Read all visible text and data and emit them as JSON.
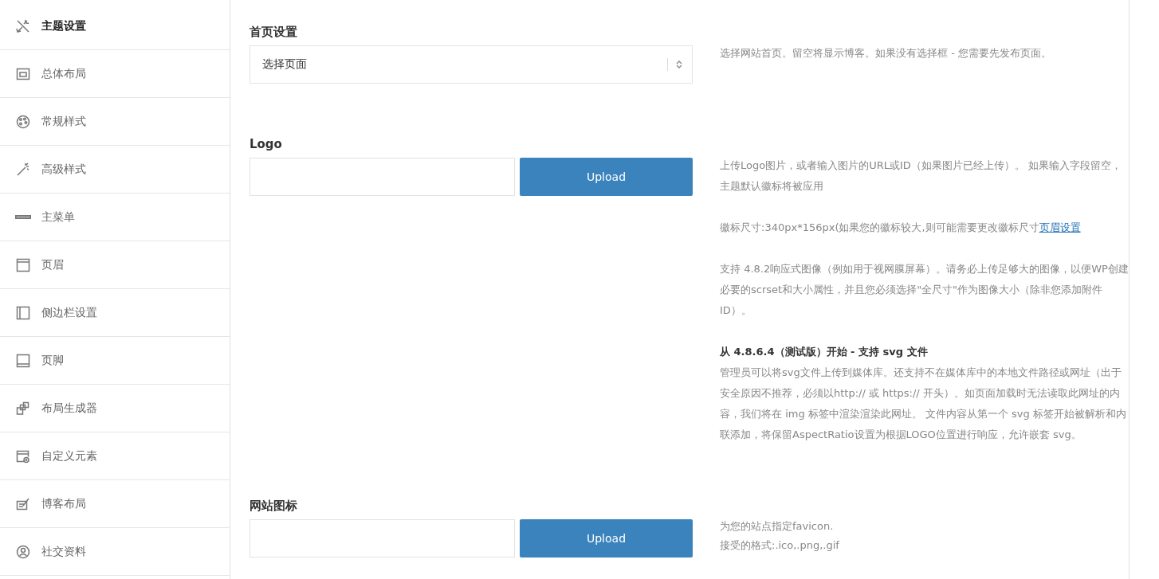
{
  "sidebar": {
    "items": [
      {
        "label": "主题设置",
        "selected": true
      },
      {
        "label": "总体布局",
        "selected": false
      },
      {
        "label": "常规样式",
        "selected": false
      },
      {
        "label": "高级样式",
        "selected": false
      },
      {
        "label": "主菜单",
        "selected": false
      },
      {
        "label": "页眉",
        "selected": false
      },
      {
        "label": "侧边栏设置",
        "selected": false
      },
      {
        "label": "页脚",
        "selected": false
      },
      {
        "label": "布局生成器",
        "selected": false
      },
      {
        "label": "自定义元素",
        "selected": false
      },
      {
        "label": "博客布局",
        "selected": false
      },
      {
        "label": "社交资料",
        "selected": false
      }
    ]
  },
  "settings": [
    {
      "kind": "select",
      "label": "首页设置",
      "value": "选择页面",
      "description": [
        {
          "kind": "text",
          "text": "选择网站首页。留空将显示博客。如果没有选择框 - 您需要先发布页面。"
        }
      ]
    },
    {
      "kind": "upload",
      "label": "Logo",
      "button": "Upload",
      "description": [
        {
          "kind": "text",
          "text": "上传Logo图片，或者输入图片的URL或ID（如果图片已经上传）。 如果输入字段留空，主题默认徽标将被应用"
        },
        {
          "kind": "text",
          "text": "徽标尺寸:340px*156px(如果您的徽标较大,则可能需要更改徽标尺寸",
          "link": "页眉设置"
        },
        {
          "kind": "text",
          "text": "支持 4.8.2响应式图像（例如用于视网膜屏幕）。请务必上传足够大的图像，以便WP创建必要的scrset和大小属性，并且您必须选择\"全尺寸\"作为图像大小（除非您添加附件 ID）。"
        },
        {
          "kind": "heading",
          "text": "从 4.8.6.4（测试版）开始 - 支持 svg 文件"
        },
        {
          "kind": "text",
          "text": "管理员可以将svg文件上传到媒体库。还支持不在媒体库中的本地文件路径或网址（出于安全原因不推荐，必须以http:// 或 https:// 开头）。如页面加载时无法读取此网址的内容，我们将在 img 标签中渲染渲染此网址。 文件内容从第一个 svg 标签开始被解析和内联添加，将保留AspectRatio设置为根据LOGO位置进行响应，允许嵌套 svg。"
        }
      ]
    },
    {
      "kind": "upload",
      "label": "网站图标",
      "button": "Upload",
      "description": [
        {
          "kind": "line",
          "text": "为您的站点指定favicon."
        },
        {
          "kind": "line",
          "text": "接受的格式:.ico,.png,.gif"
        }
      ]
    }
  ]
}
